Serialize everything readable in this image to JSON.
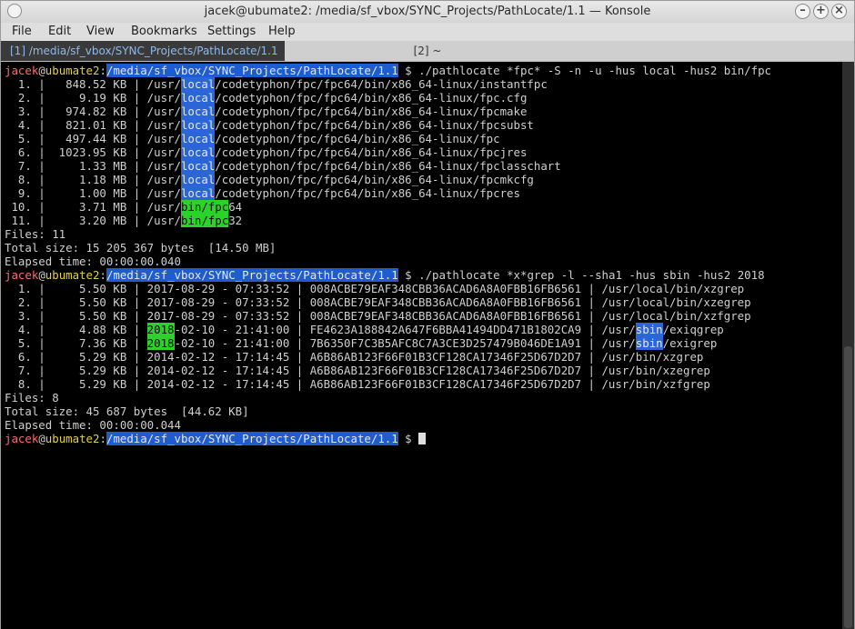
{
  "window": {
    "title": "jacek@ubumate2: /media/sf_vbox/SYNC_Projects/PathLocate/1.1 — Konsole",
    "buttons": {
      "minimize": "–",
      "maximize": "+",
      "close": "×"
    }
  },
  "menu": [
    "File",
    "Edit",
    "View",
    "Bookmarks",
    "Settings",
    "Help"
  ],
  "tabs": [
    {
      "label": "[1] /media/sf_vbox/SYNC_Projects/PathLocate/1.1",
      "active": true
    },
    {
      "label": "[2] ~",
      "active": false
    }
  ],
  "prompt": {
    "user": "jacek",
    "at": "@",
    "host": "ubumate2",
    "colon": ":",
    "path": "/media/sf_vbox/SYNC_Projects/PathLocate/1.1",
    "symbol": " $ "
  },
  "commands": [
    "./pathlocate *fpc* -S -n -u -hus local -hus2 bin/fpc",
    "./pathlocate *x*grep -l --sha1 -hus sbin -hus2 2018"
  ],
  "output1": {
    "rows": [
      {
        "pre": "  1. |   848.52 KB | /usr/",
        "hl": "local",
        "post": "/codetyphon/fpc/fpc64/bin/x86_64-linux/instantfpc"
      },
      {
        "pre": "  2. |     9.19 KB | /usr/",
        "hl": "local",
        "post": "/codetyphon/fpc/fpc64/bin/x86_64-linux/fpc.cfg"
      },
      {
        "pre": "  3. |   974.82 KB | /usr/",
        "hl": "local",
        "post": "/codetyphon/fpc/fpc64/bin/x86_64-linux/fpcmake"
      },
      {
        "pre": "  4. |   821.01 KB | /usr/",
        "hl": "local",
        "post": "/codetyphon/fpc/fpc64/bin/x86_64-linux/fpcsubst"
      },
      {
        "pre": "  5. |   497.44 KB | /usr/",
        "hl": "local",
        "post": "/codetyphon/fpc/fpc64/bin/x86_64-linux/fpc"
      },
      {
        "pre": "  6. |  1023.95 KB | /usr/",
        "hl": "local",
        "post": "/codetyphon/fpc/fpc64/bin/x86_64-linux/fpcjres"
      },
      {
        "pre": "  7. |     1.33 MB | /usr/",
        "hl": "local",
        "post": "/codetyphon/fpc/fpc64/bin/x86_64-linux/fpclasschart"
      },
      {
        "pre": "  8. |     1.18 MB | /usr/",
        "hl": "local",
        "post": "/codetyphon/fpc/fpc64/bin/x86_64-linux/fpcmkcfg"
      },
      {
        "pre": "  9. |     1.00 MB | /usr/",
        "hl": "local",
        "post": "/codetyphon/fpc/fpc64/bin/x86_64-linux/fpcres"
      },
      {
        "pre": " 10. |     3.71 MB | /usr/",
        "hl": "bin/fpc",
        "post": "64",
        "green": true
      },
      {
        "pre": " 11. |     3.20 MB | /usr/",
        "hl": "bin/fpc",
        "post": "32",
        "green": true
      }
    ],
    "files": "Files: 11",
    "total": "Total size: 15 205 367 bytes  [14.50 MB]",
    "elapsed": "Elapsed time: 00:00:00.040"
  },
  "output2": {
    "rows": [
      {
        "pre": "  1. |     5.50 KB | ",
        "hl": "",
        "post": "2017-08-29 - 07:33:52 | 008ACBE79EAF348CBB36ACAD6A8A0FBB16FB6561 | /usr/local/bin/xzgrep"
      },
      {
        "pre": "  2. |     5.50 KB | ",
        "hl": "",
        "post": "2017-08-29 - 07:33:52 | 008ACBE79EAF348CBB36ACAD6A8A0FBB16FB6561 | /usr/local/bin/xzegrep"
      },
      {
        "pre": "  3. |     5.50 KB | ",
        "hl": "",
        "post": "2017-08-29 - 07:33:52 | 008ACBE79EAF348CBB36ACAD6A8A0FBB16FB6561 | /usr/local/bin/xzfgrep"
      },
      {
        "pre": "  4. |     4.88 KB | ",
        "hl": "2018",
        "mid": "-02-10 - 21:41:00 | FE4623A188842A647F6BBA41494DD471B1802CA9 | /usr/",
        "hl2": "sbin",
        "post": "/exiqgrep"
      },
      {
        "pre": "  5. |     7.36 KB | ",
        "hl": "2018",
        "mid": "-02-10 - 21:41:00 | 7B6350F7C3B5AFC8C7A3CE3D257479B046DE1A91 | /usr/",
        "hl2": "sbin",
        "post": "/exigrep"
      },
      {
        "pre": "  6. |     5.29 KB | ",
        "hl": "",
        "post": "2014-02-12 - 17:14:45 | A6B86AB123F66F01B3CF128CA17346F25D67D2D7 | /usr/bin/xzgrep"
      },
      {
        "pre": "  7. |     5.29 KB | ",
        "hl": "",
        "post": "2014-02-12 - 17:14:45 | A6B86AB123F66F01B3CF128CA17346F25D67D2D7 | /usr/bin/xzegrep"
      },
      {
        "pre": "  8. |     5.29 KB | ",
        "hl": "",
        "post": "2014-02-12 - 17:14:45 | A6B86AB123F66F01B3CF128CA17346F25D67D2D7 | /usr/bin/xzfgrep"
      }
    ],
    "files": "Files: 8",
    "total": "Total size: 45 687 bytes  [44.62 KB]",
    "elapsed": "Elapsed time: 00:00:00.044"
  }
}
